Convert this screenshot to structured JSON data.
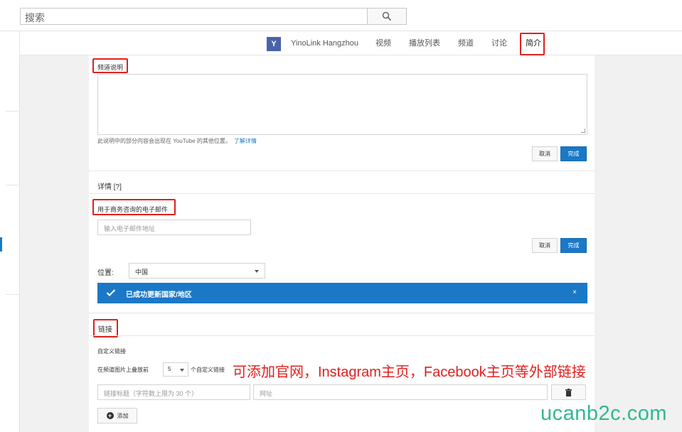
{
  "search": {
    "placeholder": "搜索"
  },
  "nav": {
    "avatar_letter": "Y",
    "channel_name": "YinoLink Hangzhou",
    "tabs": [
      "视频",
      "播放列表",
      "频道",
      "讨论",
      "简介"
    ]
  },
  "description": {
    "label": "频道说明",
    "hint": "此说明中的部分内容会出现在 YouTube 的其他位置。",
    "hint_link": "了解详情",
    "cancel": "取消",
    "done": "完成"
  },
  "details": {
    "title": "详情 [?]",
    "email_label": "用于商务咨询的电子邮件",
    "email_placeholder": "输入电子邮件地址",
    "cancel": "取消",
    "done": "完成"
  },
  "location": {
    "label": "位置:",
    "value": "中国",
    "success_message": "已成功更新国家/地区",
    "close_symbol": "×"
  },
  "links": {
    "title": "链接",
    "custom_label": "自定义链接",
    "overlay_prefix": "在频道图片上叠放前",
    "overlay_count": "5",
    "overlay_suffix": "个自定义链接",
    "title_placeholder": "链接标题（字符数上限为 30 个）",
    "url_placeholder": "网址",
    "add_label": "添加"
  },
  "annotation": "可添加官网，Instagram主页，Facebook主页等外部链接",
  "watermark": "ucanb2c.com",
  "colors": {
    "accent": "#1b78c7",
    "highlight": "#e0201e",
    "watermark": "#2fb892"
  }
}
